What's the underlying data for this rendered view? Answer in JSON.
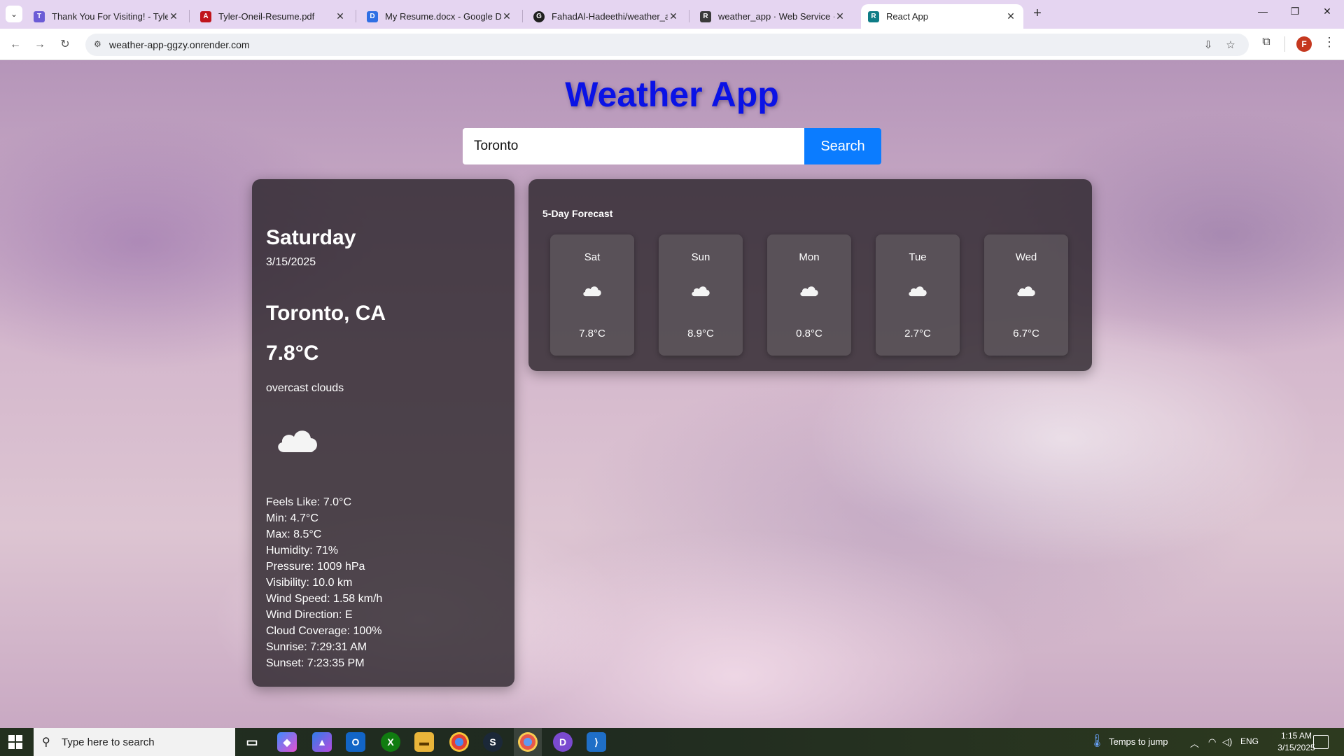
{
  "browser": {
    "tabs": [
      {
        "title": "Thank You For Visiting! - Tyler O",
        "favicon_color": "#6b5bd6",
        "favicon_letter": "T"
      },
      {
        "title": "Tyler-Oneil-Resume.pdf",
        "favicon_color": "#c0151c",
        "favicon_letter": "A"
      },
      {
        "title": "My Resume.docx - Google Docs",
        "favicon_color": "#2f6fe4",
        "favicon_letter": "D"
      },
      {
        "title": "FahadAl-Hadeethi/weather_app",
        "favicon_color": "#1f1f1f",
        "favicon_letter": "G"
      },
      {
        "title": "weather_app · Web Service · R",
        "favicon_color": "#3a3a3a",
        "favicon_letter": "R"
      },
      {
        "title": "React App",
        "favicon_color": "#0e7c86",
        "favicon_letter": "R"
      }
    ],
    "url": "weather-app-ggzy.onrender.com",
    "profile_initial": "F"
  },
  "app": {
    "title": "Weather App",
    "search": {
      "value": "Toronto",
      "button_label": "Search"
    }
  },
  "current": {
    "day": "Saturday",
    "date": "3/15/2025",
    "city": "Toronto, CA",
    "temp": "7.8°C",
    "description": "overcast clouds",
    "icon": "cloud-icon",
    "details": {
      "feels_like": "Feels Like: 7.0°C",
      "min": "Min: 4.7°C",
      "max": "Max: 8.5°C",
      "humidity": "Humidity: 71%",
      "pressure": "Pressure: 1009 hPa",
      "visibility": "Visibility: 10.0 km",
      "wind_speed": "Wind Speed: 1.58 km/h",
      "wind_direction": "Wind Direction: E",
      "cloud_coverage": "Cloud Coverage: 100%",
      "sunrise": "Sunrise: 7:29:31 AM",
      "sunset": "Sunset: 7:23:35 PM"
    }
  },
  "forecast": {
    "title": "5-Day Forecast",
    "days": [
      {
        "day": "Sat",
        "temp": "7.8°C",
        "icon": "cloud-icon"
      },
      {
        "day": "Sun",
        "temp": "8.9°C",
        "icon": "cloud-icon"
      },
      {
        "day": "Mon",
        "temp": "0.8°C",
        "icon": "cloud-icon"
      },
      {
        "day": "Tue",
        "temp": "2.7°C",
        "icon": "cloud-icon"
      },
      {
        "day": "Wed",
        "temp": "6.7°C",
        "icon": "cloud-icon"
      }
    ]
  },
  "taskbar": {
    "search_placeholder": "Type here to search",
    "weather": "Temps to jump",
    "language": "ENG",
    "time": "1:15 AM",
    "date": "3/15/2025"
  }
}
